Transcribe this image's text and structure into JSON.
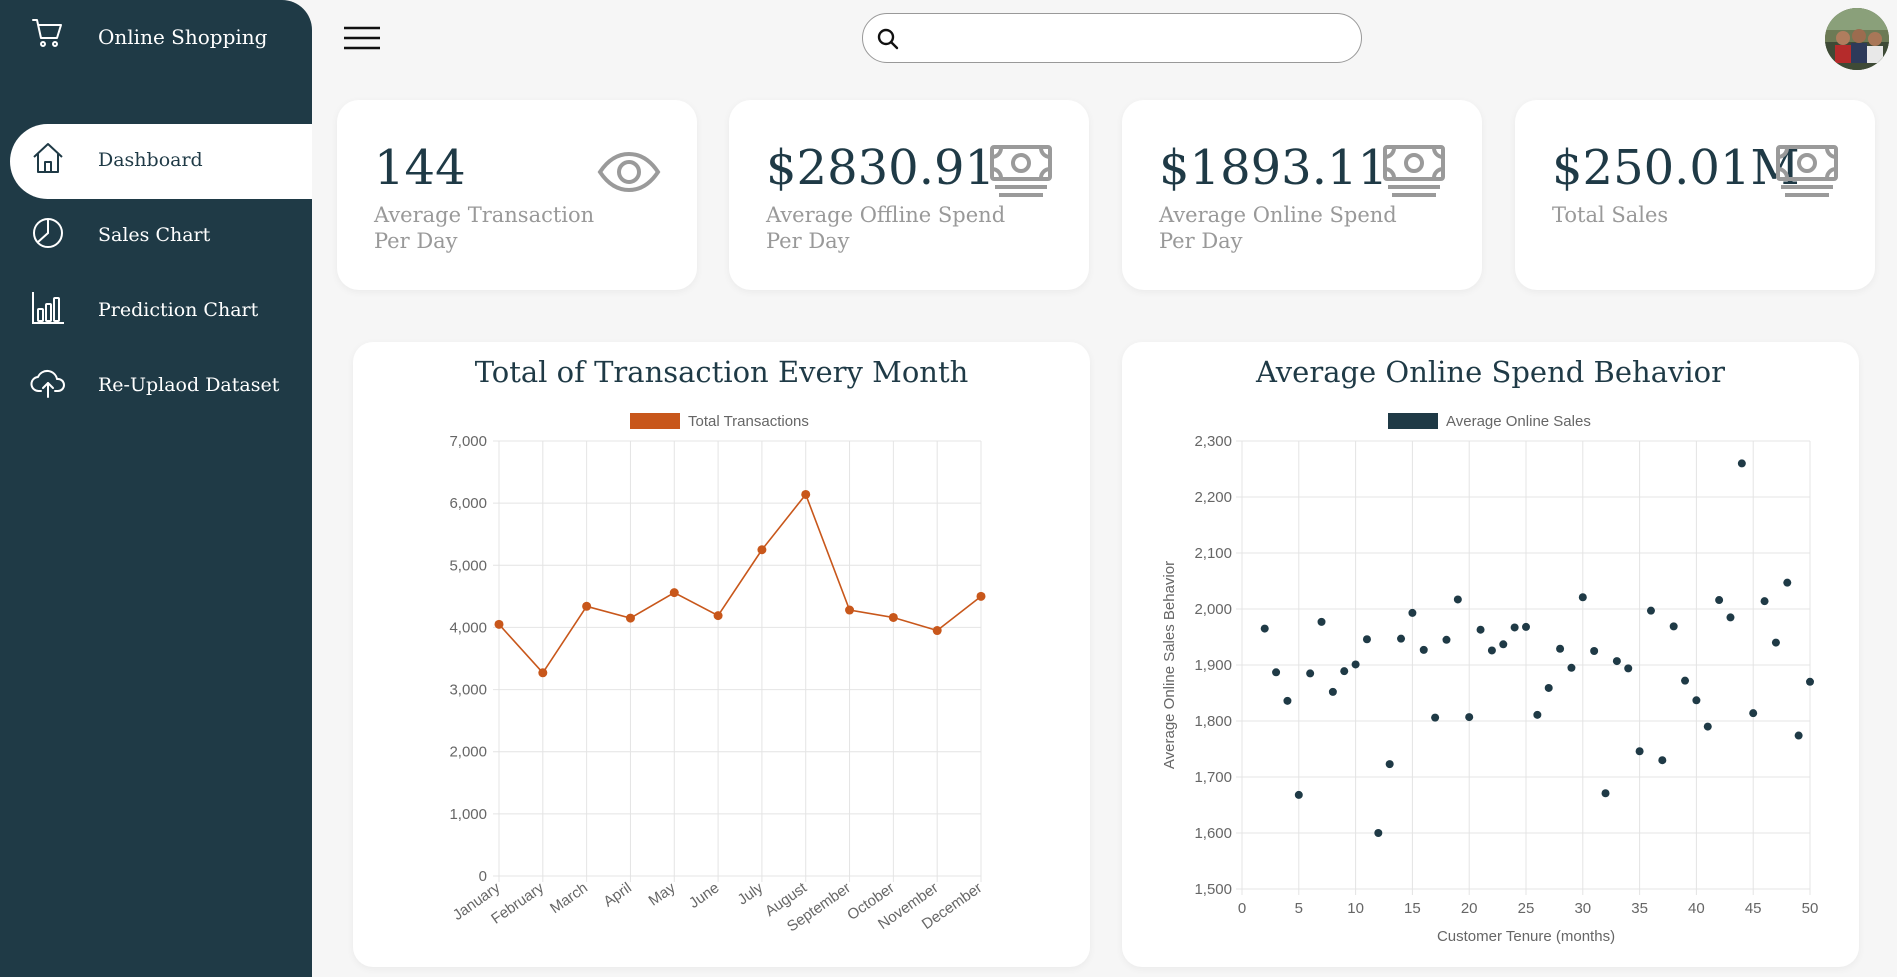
{
  "brand": {
    "label": "Online Shopping",
    "icon": "cart-icon"
  },
  "nav": [
    {
      "label": "Dashboard",
      "icon": "home-icon",
      "active": true
    },
    {
      "label": "Sales Chart",
      "icon": "pie-chart-icon",
      "active": false
    },
    {
      "label": "Prediction Chart",
      "icon": "bar-chart-icon",
      "active": false
    },
    {
      "label": "Re-Uplaod Dataset",
      "icon": "cloud-upload-icon",
      "active": false
    }
  ],
  "search": {
    "placeholder": "",
    "value": ""
  },
  "cards": [
    {
      "value": "144",
      "label": "Average Transaction Per Day",
      "icon": "eye-icon"
    },
    {
      "value": "$2830.91",
      "label": "Average Offline Spend Per Day",
      "icon": "money-icon"
    },
    {
      "value": "$1893.11",
      "label": "Average Online Spend Per Day",
      "icon": "money-icon"
    },
    {
      "value": "$250.01M",
      "label": "Total Sales",
      "icon": "money-icon"
    }
  ],
  "colors": {
    "sidebar": "#1f3a46",
    "accent": "#c8571b",
    "scatter": "#1f3a46",
    "muted": "#999999"
  },
  "chart_data": [
    {
      "type": "line",
      "title": "Total of Transaction Every Month",
      "legend": "Total Transactions",
      "legend_position": "top",
      "categories": [
        "January",
        "February",
        "March",
        "April",
        "May",
        "June",
        "July",
        "August",
        "September",
        "October",
        "November",
        "December"
      ],
      "values": [
        4050,
        3270,
        4340,
        4150,
        4560,
        4190,
        5250,
        6140,
        4280,
        4160,
        3950,
        4500
      ],
      "ylim": [
        0,
        7000
      ],
      "yticks": [
        "0",
        "1,000",
        "2,000",
        "3,000",
        "4,000",
        "5,000",
        "6,000",
        "7,000"
      ],
      "grid": true,
      "color": "#c8571b"
    },
    {
      "type": "scatter",
      "title": "Average Online Spend Behavior",
      "legend": "Average Online Sales",
      "legend_position": "top",
      "xlabel": "Customer Tenure (months)",
      "ylabel": "Average Online Sales Behavior",
      "xlim": [
        0,
        50
      ],
      "ylim": [
        1500,
        2300
      ],
      "xticks": [
        "0",
        "5",
        "10",
        "15",
        "20",
        "25",
        "30",
        "35",
        "40",
        "45",
        "50"
      ],
      "yticks": [
        "1,500",
        "1,600",
        "1,700",
        "1,800",
        "1,900",
        "2,000",
        "2,100",
        "2,200",
        "2,300"
      ],
      "grid": true,
      "color": "#1f3a46",
      "points": [
        [
          2,
          1965
        ],
        [
          3,
          1887
        ],
        [
          4,
          1836
        ],
        [
          5,
          1668
        ],
        [
          6,
          1885
        ],
        [
          7,
          1977
        ],
        [
          8,
          1852
        ],
        [
          9,
          1889
        ],
        [
          10,
          1901
        ],
        [
          11,
          1946
        ],
        [
          12,
          1600
        ],
        [
          13,
          1723
        ],
        [
          14,
          1947
        ],
        [
          15,
          1993
        ],
        [
          16,
          1927
        ],
        [
          17,
          1806
        ],
        [
          18,
          1945
        ],
        [
          19,
          2017
        ],
        [
          20,
          1807
        ],
        [
          21,
          1963
        ],
        [
          22,
          1926
        ],
        [
          23,
          1937
        ],
        [
          24,
          1967
        ],
        [
          25,
          1968
        ],
        [
          26,
          1811
        ],
        [
          27,
          1859
        ],
        [
          28,
          1929
        ],
        [
          29,
          1895
        ],
        [
          30,
          2021
        ],
        [
          31,
          1925
        ],
        [
          32,
          1671
        ],
        [
          33,
          1907
        ],
        [
          34,
          1894
        ],
        [
          35,
          1746
        ],
        [
          36,
          1997
        ],
        [
          37,
          1730
        ],
        [
          38,
          1969
        ],
        [
          39,
          1872
        ],
        [
          40,
          1837
        ],
        [
          41,
          1790
        ],
        [
          42,
          2016
        ],
        [
          43,
          1985
        ],
        [
          44,
          2260
        ],
        [
          45,
          1814
        ],
        [
          46,
          2014
        ],
        [
          47,
          1940
        ],
        [
          48,
          2047
        ],
        [
          49,
          1774
        ],
        [
          50,
          1870
        ]
      ]
    }
  ]
}
